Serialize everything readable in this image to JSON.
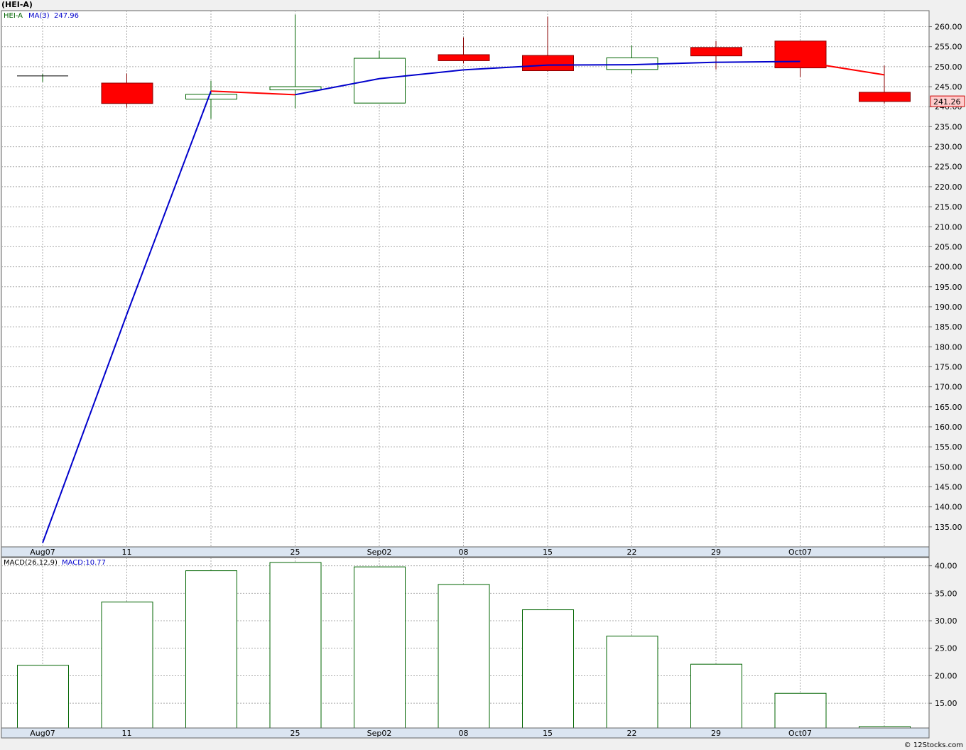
{
  "header": {
    "symbol_title": "(HEI-A)"
  },
  "footer": {
    "credit": "© 12Stocks.com"
  },
  "colors": {
    "up": "#006400",
    "down": "#ff0000",
    "ma": "#0000cc",
    "grid": "#aaaaaa"
  },
  "chart_data": [
    {
      "type": "candlestick",
      "legend": {
        "symbol": "HEI-A",
        "ma_label": "MA(3)",
        "ma_value": "247.96"
      },
      "last_price_label": "241.26",
      "x_tick_labels": [
        "Aug07",
        "11",
        "",
        "25",
        "Sep02",
        "08",
        "15",
        "22",
        "29",
        "Oct07",
        ""
      ],
      "ylim": [
        130,
        264
      ],
      "y_ticks": [
        135,
        140,
        145,
        150,
        155,
        160,
        165,
        170,
        175,
        180,
        185,
        190,
        195,
        200,
        205,
        210,
        215,
        220,
        225,
        230,
        235,
        240,
        245,
        250,
        255,
        260
      ],
      "candles": [
        {
          "open": 247.7,
          "high": 248.2,
          "low": 246.2,
          "close": 247.7
        },
        {
          "open": 245.9,
          "high": 248.3,
          "low": 239.8,
          "close": 240.8
        },
        {
          "open": 241.9,
          "high": 246.5,
          "low": 237.0,
          "close": 243.1
        },
        {
          "open": 244.2,
          "high": 263.0,
          "low": 239.6,
          "close": 245.0
        },
        {
          "open": 240.9,
          "high": 254.0,
          "low": 240.9,
          "close": 252.1
        },
        {
          "open": 253.0,
          "high": 257.3,
          "low": 250.8,
          "close": 251.5
        },
        {
          "open": 252.8,
          "high": 262.5,
          "low": 248.8,
          "close": 249.0
        },
        {
          "open": 249.3,
          "high": 255.3,
          "low": 248.3,
          "close": 252.2
        },
        {
          "open": 254.8,
          "high": 256.4,
          "low": 249.3,
          "close": 252.7
        },
        {
          "open": 256.4,
          "high": 256.4,
          "low": 247.4,
          "close": 249.7
        },
        {
          "open": 243.6,
          "high": 250.3,
          "low": 240.8,
          "close": 241.3
        }
      ],
      "ma3": [
        131.0,
        188.1,
        243.9,
        243.0,
        247.0,
        249.2,
        250.4,
        250.5,
        251.1,
        251.3,
        247.96
      ]
    },
    {
      "type": "bar",
      "legend": {
        "label": "MACD(26,12,9)",
        "value_label": "MACD:10.77"
      },
      "x_tick_labels": [
        "Aug07",
        "11",
        "",
        "25",
        "Sep02",
        "08",
        "15",
        "22",
        "29",
        "Oct07",
        ""
      ],
      "ylim": [
        10.5,
        41.5
      ],
      "y_ticks": [
        15,
        20,
        25,
        30,
        35,
        40
      ],
      "values": [
        21.9,
        33.4,
        39.1,
        40.6,
        39.8,
        36.6,
        32.0,
        27.2,
        22.1,
        16.8,
        10.77
      ]
    }
  ]
}
